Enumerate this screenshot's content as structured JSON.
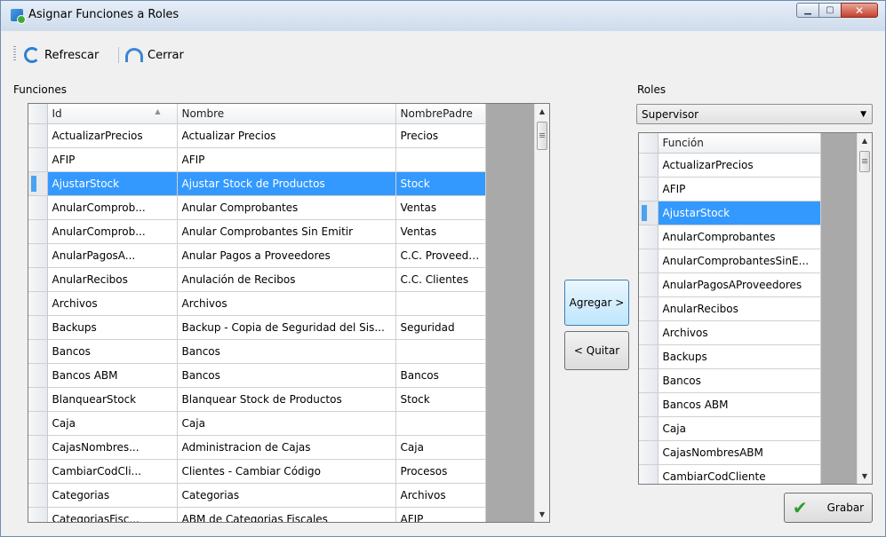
{
  "window": {
    "title": "Asignar Funciones a Roles"
  },
  "toolbar": {
    "refresh_label": "Refrescar",
    "close_label": "Cerrar"
  },
  "funciones": {
    "label": "Funciones",
    "columns": [
      "Id",
      "Nombre",
      "NombrePadre"
    ],
    "sort_indicator": "▲",
    "rows": [
      [
        "ActualizarPrecios",
        "Actualizar Precios",
        "Precios"
      ],
      [
        "AFIP",
        "AFIP",
        ""
      ],
      [
        "AjustarStock",
        "Ajustar Stock de Productos",
        "Stock"
      ],
      [
        "AnularComprob...",
        "Anular Comprobantes",
        "Ventas"
      ],
      [
        "AnularComprob...",
        "Anular Comprobantes Sin Emitir",
        "Ventas"
      ],
      [
        "AnularPagosA...",
        "Anular Pagos a Proveedores",
        "C.C. Proveedores"
      ],
      [
        "AnularRecibos",
        "Anulación de Recibos",
        "C.C. Clientes"
      ],
      [
        "Archivos",
        "Archivos",
        ""
      ],
      [
        "Backups",
        "Backup - Copia de Seguridad del Sis...",
        "Seguridad"
      ],
      [
        "Bancos",
        "Bancos",
        ""
      ],
      [
        "Bancos ABM",
        "Bancos",
        "Bancos"
      ],
      [
        "BlanquearStock",
        "Blanquear Stock de Productos",
        "Stock"
      ],
      [
        "Caja",
        "Caja",
        ""
      ],
      [
        "CajasNombres...",
        "Administracion de Cajas",
        "Caja"
      ],
      [
        "CambiarCodCli...",
        "Clientes - Cambiar Código",
        "Procesos"
      ],
      [
        "Categorias",
        "Categorias",
        "Archivos"
      ],
      [
        "CategoriasFisc...",
        "ABM de Categorias Fiscales",
        "AFIP"
      ]
    ],
    "selected_row": 2
  },
  "buttons": {
    "agregar": "Agregar >",
    "quitar": "< Quitar",
    "grabar": "Grabar"
  },
  "roles": {
    "label": "Roles",
    "selected": "Supervisor",
    "column": "Función",
    "rows": [
      "ActualizarPrecios",
      "AFIP",
      "AjustarStock",
      "AnularComprobantes",
      "AnularComprobantesSinE...",
      "AnularPagosAProveedores",
      "AnularRecibos",
      "Archivos",
      "Backups",
      "Bancos",
      "Bancos ABM",
      "Caja",
      "CajasNombresABM",
      "CambiarCodCliente"
    ],
    "selected_row": 2
  },
  "colors": {
    "selection": "#3399ff",
    "grid_bg": "#a9a9a9"
  }
}
